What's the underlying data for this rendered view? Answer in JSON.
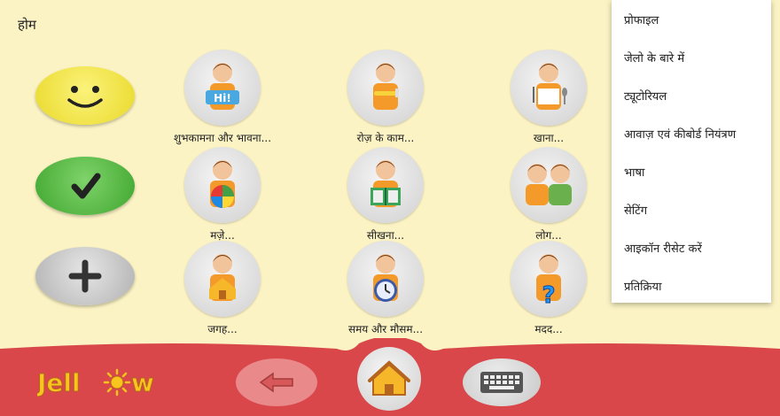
{
  "header": {
    "title": "होम"
  },
  "side_buttons": [
    "smiley-button",
    "yes-button",
    "more-button"
  ],
  "tiles": [
    {
      "label": "शुभकामना और भावना..."
    },
    {
      "label": "रोज़ के काम..."
    },
    {
      "label": "खाना..."
    },
    {
      "label": "मज़े..."
    },
    {
      "label": "सीखना..."
    },
    {
      "label": "लोग..."
    },
    {
      "label": "जगह..."
    },
    {
      "label": "समय और मौसम..."
    },
    {
      "label": "मदद..."
    }
  ],
  "menu": {
    "items": [
      "प्रोफाइल",
      "जेलो के बारे में",
      "ट्यूटोरियल",
      "आवाज़ एवं कीबोर्ड नियंत्रण",
      "भाषा",
      "सेटिंग",
      "आइकॉन रीसेट करें",
      "प्रतिक्रिया"
    ]
  },
  "logo": {
    "text_left": "Jell",
    "text_right": "w"
  },
  "colors": {
    "background": "#fbf3c4",
    "bar": "#d9474b",
    "smiley": "#f7e94a",
    "yes": "#5bbf4a",
    "more": "#c8c8c8"
  }
}
